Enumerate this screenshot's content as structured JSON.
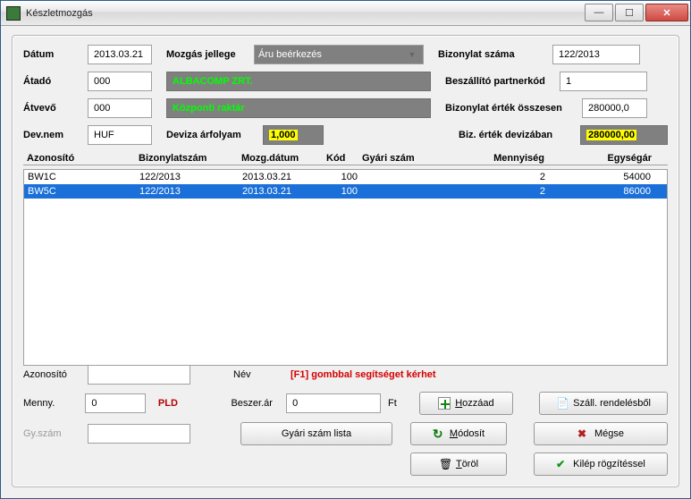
{
  "window": {
    "title": "Készletmozgás"
  },
  "header": {
    "labels": {
      "datum": "Dátum",
      "mozgas_jellege": "Mozgás jellege",
      "bizonylat_szama": "Bizonylat száma",
      "atado": "Átadó",
      "beszallito_partnerkod": "Beszállító partnerkód",
      "atvevo": "Átvevő",
      "bizonylat_ertek_osszesen": "Bizonylat érték összesen",
      "devnem": "Dev.nem",
      "deviza_arfolyam": "Deviza árfolyam",
      "biz_ertek_devizaban": "Biz. érték devizában"
    },
    "values": {
      "datum": "2013.03.21",
      "mozgas_jellege": "Áru beérkezés",
      "bizonylat_szama": "122/2013",
      "atado": "000",
      "atado_nev": "ALBACOMP ZRT.",
      "beszallito_partnerkod": "1",
      "atvevo": "000",
      "atvevo_nev": "Központi raktár",
      "bizonylat_ertek_osszesen": "280000,0",
      "devnem": "HUF",
      "deviza_arfolyam": "1,000",
      "biz_ertek_devizaban": "280000,00"
    }
  },
  "grid": {
    "columns": {
      "azonosito": "Azonosító",
      "bizonylatszam": "Bizonylatszám",
      "mozg_datum": "Mozg.dátum",
      "kod": "Kód",
      "gyari_szam": "Gyári szám",
      "mennyiseg": "Mennyiség",
      "egysegar": "Egységár"
    },
    "rows": [
      {
        "azonosito": "BW1C",
        "biz": "122/2013",
        "datum": "2013.03.21",
        "kod": "100",
        "gyari": "",
        "menny": "2",
        "ar": "54000",
        "selected": false
      },
      {
        "azonosito": "BW5C",
        "biz": "122/2013",
        "datum": "2013.03.21",
        "kod": "100",
        "gyari": "",
        "menny": "2",
        "ar": "86000",
        "selected": true
      }
    ]
  },
  "entry": {
    "labels": {
      "azonosito": "Azonosító",
      "nev": "Név",
      "menny": "Menny.",
      "unit": "PLD",
      "beszer_ar": "Beszer.ár",
      "ft": "Ft",
      "gyszam": "Gy.szám"
    },
    "values": {
      "azonosito": "",
      "menny": "0",
      "beszer_ar": "0",
      "gyszam": ""
    },
    "help": "[F1] gombbal segítséget kérhet"
  },
  "buttons": {
    "gyari_szam_lista": "Gyári szám lista",
    "hozzaad": "Hozzáad",
    "modosit": "Módosít",
    "torol": "Töröl",
    "szall_rendelesbol": "Száll. rendelésből",
    "megse": "Mégse",
    "kilep": "Kilép rögzítéssel"
  }
}
